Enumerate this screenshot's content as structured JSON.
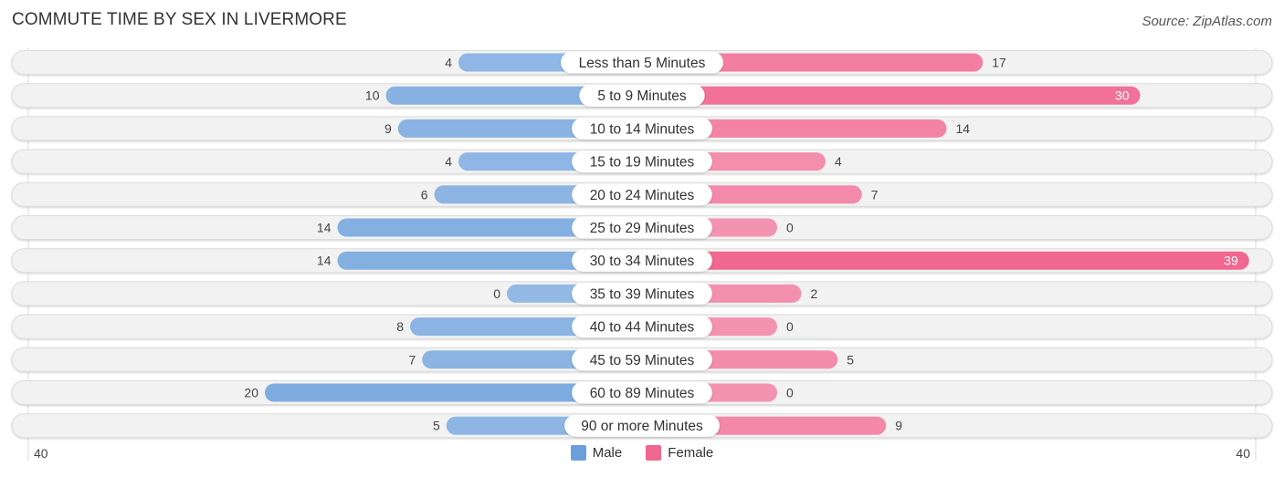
{
  "header": {
    "title": "COMMUTE TIME BY SEX IN LIVERMORE",
    "source": "Source: ZipAtlas.com"
  },
  "colors": {
    "male": "#6a9fdb",
    "male_light": "#a9c7ea",
    "female": "#f06790",
    "female_light": "#f6a9c2",
    "track": "#f2f2f2"
  },
  "chart_data": {
    "type": "bar",
    "orientation": "horizontal-diverging",
    "title": "COMMUTE TIME BY SEX IN LIVERMORE",
    "categories": [
      "Less than 5 Minutes",
      "5 to 9 Minutes",
      "10 to 14 Minutes",
      "15 to 19 Minutes",
      "20 to 24 Minutes",
      "25 to 29 Minutes",
      "30 to 34 Minutes",
      "35 to 39 Minutes",
      "40 to 44 Minutes",
      "45 to 59 Minutes",
      "60 to 89 Minutes",
      "90 or more Minutes"
    ],
    "series": [
      {
        "name": "Male",
        "values": [
          4,
          10,
          9,
          4,
          6,
          14,
          14,
          0,
          8,
          7,
          20,
          5
        ]
      },
      {
        "name": "Female",
        "values": [
          17,
          30,
          14,
          4,
          7,
          0,
          39,
          2,
          0,
          5,
          0,
          9
        ]
      }
    ],
    "axis": {
      "left_label": "40",
      "right_label": "40",
      "max": 40
    },
    "legend": {
      "position": "bottom-center",
      "entries": [
        "Male",
        "Female"
      ]
    },
    "grid": false
  }
}
